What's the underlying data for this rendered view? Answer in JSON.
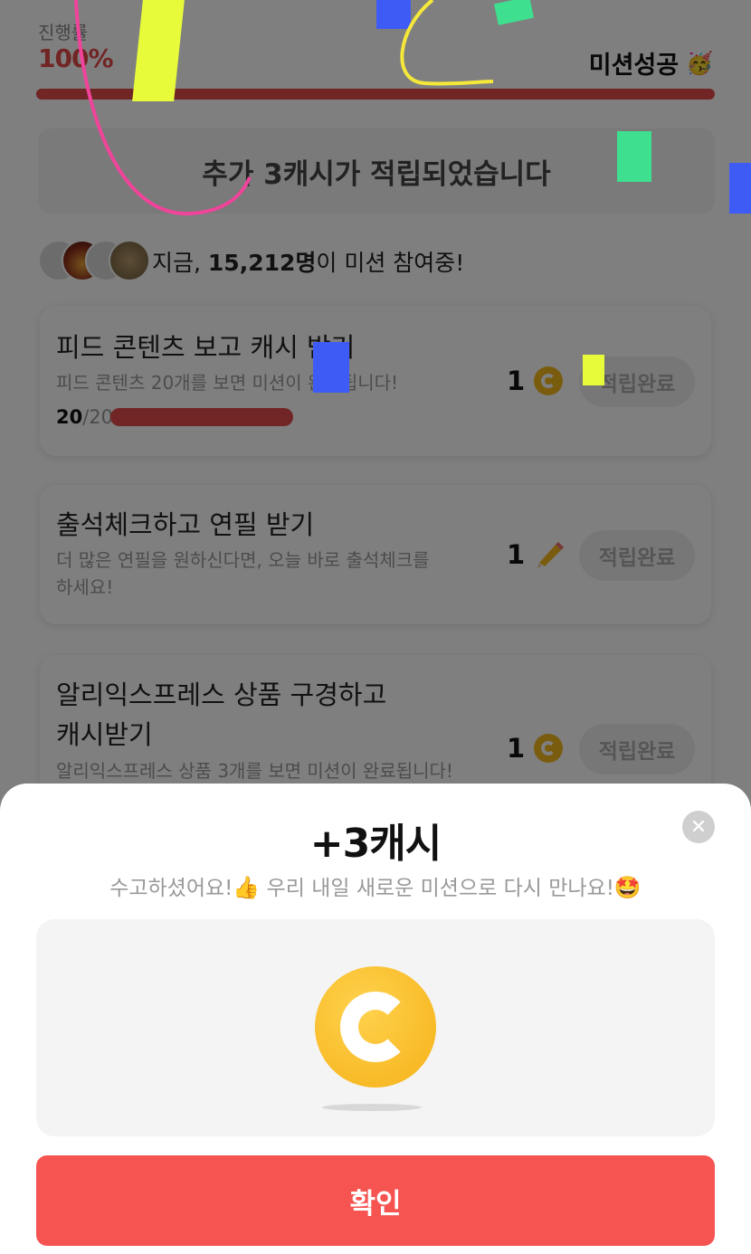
{
  "header": {
    "progress_label": "진행률",
    "progress_value": "100%",
    "progress_fraction": 1.0,
    "mission_status": "미션성공",
    "mission_emoji": "🥳"
  },
  "notice": {
    "text": "추가 3캐시가 적립되었습니다"
  },
  "participants": {
    "prefix": "지금, ",
    "count": "15,212명",
    "suffix": "이 미션 참여중!"
  },
  "missions": [
    {
      "title": "피드 콘텐츠 보고 캐시 받기",
      "desc": "피드 콘텐츠 20개를 보면 미션이 완료됩니다!",
      "progress_current": "20",
      "progress_total": "/20",
      "progress_fraction": 1.0,
      "reward": "1",
      "reward_icon": "coin-icon",
      "button": "적립완료"
    },
    {
      "title": "출석체크하고 연필 받기",
      "desc_line1": "더 많은 연필을 원하신다면, 오늘 바로 출석체크를",
      "desc_line2": "하세요!",
      "reward": "1",
      "reward_icon": "pencil-icon",
      "button": "적립완료"
    },
    {
      "title_line1": "알리익스프레스 상품 구경하고",
      "title_line2": "캐시받기",
      "desc": "알리익스프레스 상품 3개를 보면 미션이 완료됩니다!",
      "reward": "1",
      "reward_icon": "coin-icon",
      "button": "적립완료"
    }
  ],
  "sheet": {
    "title": "+3캐시",
    "subtitle_part1": "수고하셨어요!",
    "subtitle_emoji1": "👍",
    "subtitle_part2": " 우리 내일 새로운 미션으로 다시 만나요!",
    "subtitle_emoji2": "🤩",
    "close_icon": "close-icon",
    "confirm_label": "확인"
  },
  "colors": {
    "accent_red": "#e24a4a",
    "confirm_red": "#f55451",
    "coin_yellow": "#f5b81f"
  }
}
